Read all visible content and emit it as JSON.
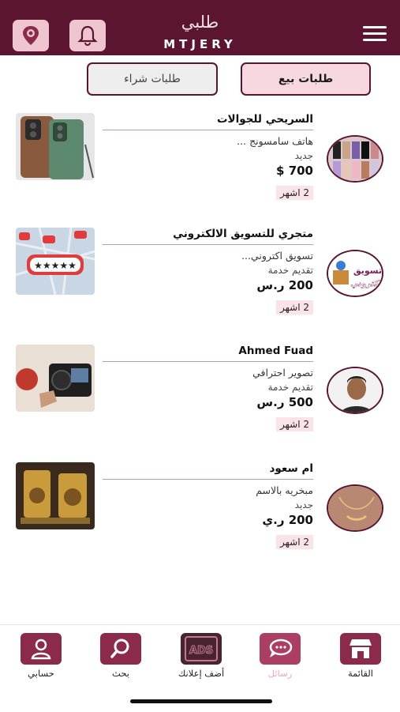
{
  "header": {
    "title_ar": "طلبي",
    "title_en": "MTJERY",
    "bg": "#5b1530",
    "left_icons": [
      "location-pin-icon",
      "bell-icon"
    ],
    "right_icon": "hamburger-menu-icon"
  },
  "tabs": [
    {
      "label": "طلبات بيع",
      "active": true
    },
    {
      "label": "طلبات شراء",
      "active": false
    }
  ],
  "listings": [
    {
      "title": "السريحي للجوالات",
      "description": "هاتف سامسونج ...",
      "category": "جديد",
      "price": "700 $",
      "time": "2 اشهر"
    },
    {
      "title": "متجري للتسويق الالكتروني",
      "description": "تسويق اكتروني...",
      "category": "تقديم خدمة",
      "price": "200 ر.س",
      "time": "2 اشهر",
      "avatar_text": [
        "تسويق",
        "الكتروني"
      ]
    },
    {
      "title": "Ahmed Fuad",
      "description": "تصوير احترافي",
      "category": "تقديم خدمة",
      "price": "500 ر.س",
      "time": "2 اشهر"
    },
    {
      "title": "ام سعود",
      "description": "مبخريه بالاسم",
      "category": "جديد",
      "price": "200 ر.ي",
      "time": "2 اشهر"
    }
  ],
  "bottom_nav": [
    {
      "label": "القائمة",
      "icon": "store-icon"
    },
    {
      "label": "رسائل",
      "icon": "chat-icon",
      "current": true
    },
    {
      "label": "أضف إعلانك",
      "icon": "ads-icon",
      "icon_text": "ADS"
    },
    {
      "label": "بحث",
      "icon": "search-icon"
    },
    {
      "label": "حسابي",
      "icon": "user-icon"
    }
  ],
  "colors": {
    "primary": "#5b1530",
    "accent_pink": "#efc6cf",
    "nav_icon": "#8c2a4b"
  }
}
